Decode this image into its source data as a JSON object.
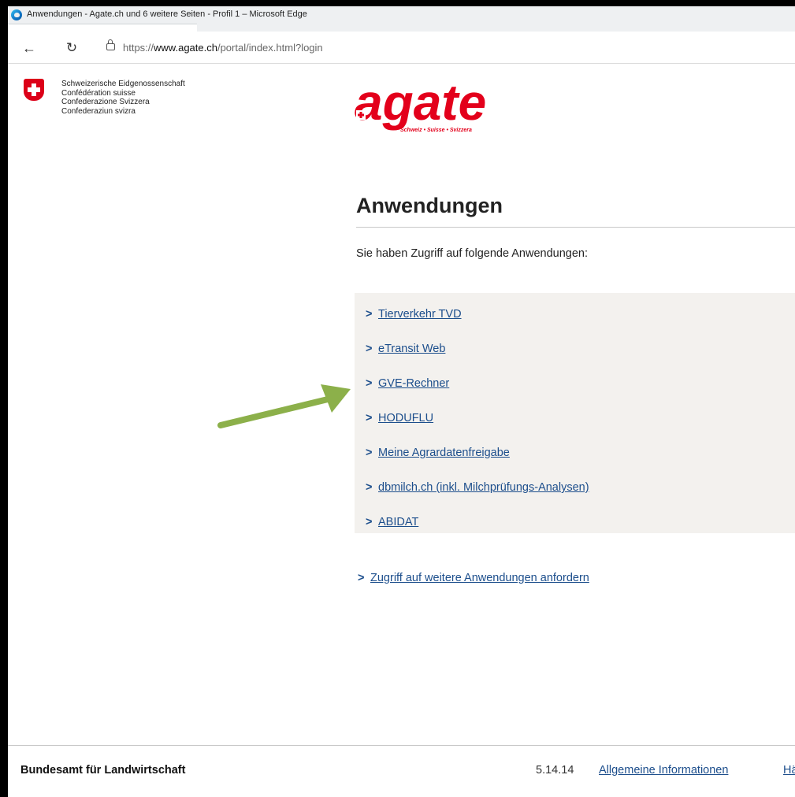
{
  "browser": {
    "window_title": "Anwendungen - Agate.ch und 6 weitere Seiten - Profil 1 – Microsoft Edge",
    "url_prefix": "https://",
    "url_domain": "www.agate.ch",
    "url_path": "/portal/index.html?login"
  },
  "header": {
    "confederation": [
      "Schweizerische Eidgenossenschaft",
      "Confédération suisse",
      "Confederazione Svizzera",
      "Confederaziun svizra"
    ],
    "logo_text": "agate",
    "logo_tagline": "Schweiz • Suisse • Svizzera"
  },
  "main": {
    "title": "Anwendungen",
    "intro": "Sie haben Zugriff auf folgende Anwendungen:",
    "apps": [
      {
        "label": "Tierverkehr TVD"
      },
      {
        "label": "eTransit Web"
      },
      {
        "label": "GVE-Rechner"
      },
      {
        "label": "HODUFLU"
      },
      {
        "label": "Meine Agrardatenfreigabe"
      },
      {
        "label": "dbmilch.ch (inkl. Milchprüfungs-Analysen)"
      },
      {
        "label": "ABIDAT"
      }
    ],
    "request_more": "Zugriff auf weitere Anwendungen anfordern"
  },
  "footer": {
    "office": "Bundesamt für Landwirtschaft",
    "version": "5.14.14",
    "info_link": "Allgemeine Informationen",
    "cut_link": "Hä"
  },
  "colors": {
    "link": "#1c4e8c",
    "accent_red": "#e3001b",
    "annotation_arrow": "#8cb04a",
    "list_bg": "#f3f1ee"
  }
}
